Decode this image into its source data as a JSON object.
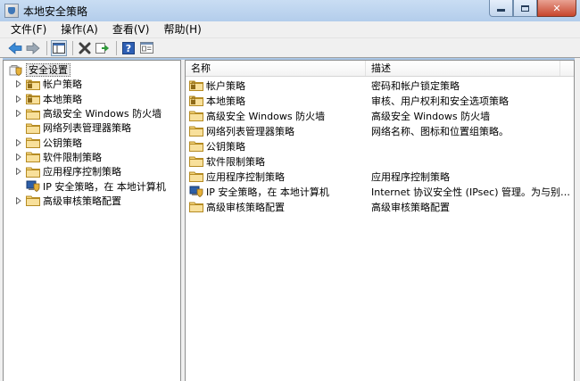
{
  "window": {
    "title": "本地安全策略",
    "close_glyph": "✕"
  },
  "menu": [
    {
      "label": "文件(F)"
    },
    {
      "label": "操作(A)"
    },
    {
      "label": "查看(V)"
    },
    {
      "label": "帮助(H)"
    }
  ],
  "toolbar": {
    "icons": [
      "back-arrow-icon",
      "forward-arrow-icon",
      "show-hide-tree-icon",
      "delete-icon",
      "export-list-icon",
      "help-icon",
      "properties-icon"
    ]
  },
  "tree": {
    "root": {
      "label": "安全设置",
      "icon": "security-settings-icon"
    },
    "items": [
      {
        "label": "帐户策略",
        "icon": "folder-lock-icon",
        "expandable": true
      },
      {
        "label": "本地策略",
        "icon": "folder-lock-icon",
        "expandable": true
      },
      {
        "label": "高级安全 Windows 防火墙",
        "icon": "folder-icon",
        "expandable": true
      },
      {
        "label": "网络列表管理器策略",
        "icon": "folder-icon",
        "expandable": false
      },
      {
        "label": "公钥策略",
        "icon": "folder-icon",
        "expandable": true
      },
      {
        "label": "软件限制策略",
        "icon": "folder-icon",
        "expandable": true
      },
      {
        "label": "应用程序控制策略",
        "icon": "folder-icon",
        "expandable": true
      },
      {
        "label": "IP 安全策略，在 本地计算机",
        "icon": "ip-security-icon",
        "expandable": false
      },
      {
        "label": "高级审核策略配置",
        "icon": "folder-icon",
        "expandable": true
      }
    ]
  },
  "list": {
    "columns": {
      "name": "名称",
      "description": "描述"
    },
    "rows": [
      {
        "name": "帐户策略",
        "description": "密码和帐户锁定策略",
        "icon": "folder-lock-icon"
      },
      {
        "name": "本地策略",
        "description": "审核、用户权利和安全选项策略",
        "icon": "folder-lock-icon"
      },
      {
        "name": "高级安全 Windows 防火墙",
        "description": "高级安全 Windows 防火墙",
        "icon": "folder-icon"
      },
      {
        "name": "网络列表管理器策略",
        "description": "网络名称、图标和位置组策略。",
        "icon": "folder-icon"
      },
      {
        "name": "公钥策略",
        "description": "",
        "icon": "folder-icon"
      },
      {
        "name": "软件限制策略",
        "description": "",
        "icon": "folder-icon"
      },
      {
        "name": "应用程序控制策略",
        "description": "应用程序控制策略",
        "icon": "folder-icon"
      },
      {
        "name": "IP 安全策略，在 本地计算机",
        "description": "Internet 协议安全性 (IPsec) 管理。为与别的...",
        "icon": "ip-security-icon"
      },
      {
        "name": "高级审核策略配置",
        "description": "高级审核策略配置",
        "icon": "folder-icon"
      }
    ]
  }
}
